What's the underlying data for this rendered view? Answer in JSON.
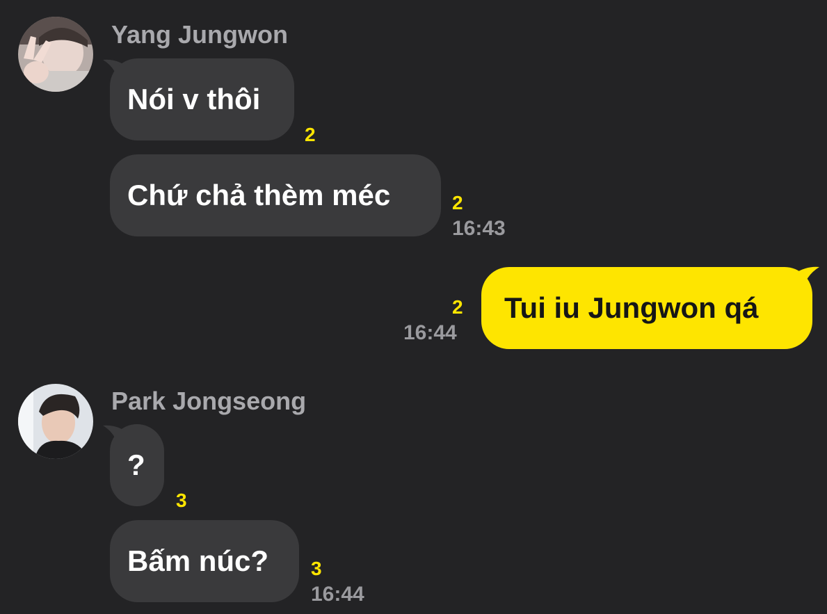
{
  "colors": {
    "background": "#232325",
    "incoming_bubble": "#3a3a3c",
    "outgoing_bubble": "#fee500",
    "unread_count": "#fee500",
    "sender_name": "#a9a9ad",
    "timestamp": "#9a9a9e"
  },
  "groups": [
    {
      "sender": "Yang Jungwon",
      "avatar_icon": "user-avatar-photo",
      "messages": [
        {
          "text": "Nói v thôi",
          "unread": "2"
        },
        {
          "text": "Chứ chả thèm méc",
          "unread": "2",
          "time": "16:43"
        }
      ]
    },
    {
      "sender": "me",
      "messages": [
        {
          "text": "Tui iu Jungwon qá",
          "unread": "2",
          "time": "16:44"
        }
      ]
    },
    {
      "sender": "Park Jongseong",
      "avatar_icon": "user-avatar-photo",
      "messages": [
        {
          "text": "?",
          "unread": "3"
        },
        {
          "text": "Bấm núc?",
          "unread": "3",
          "time": "16:44"
        }
      ]
    }
  ]
}
